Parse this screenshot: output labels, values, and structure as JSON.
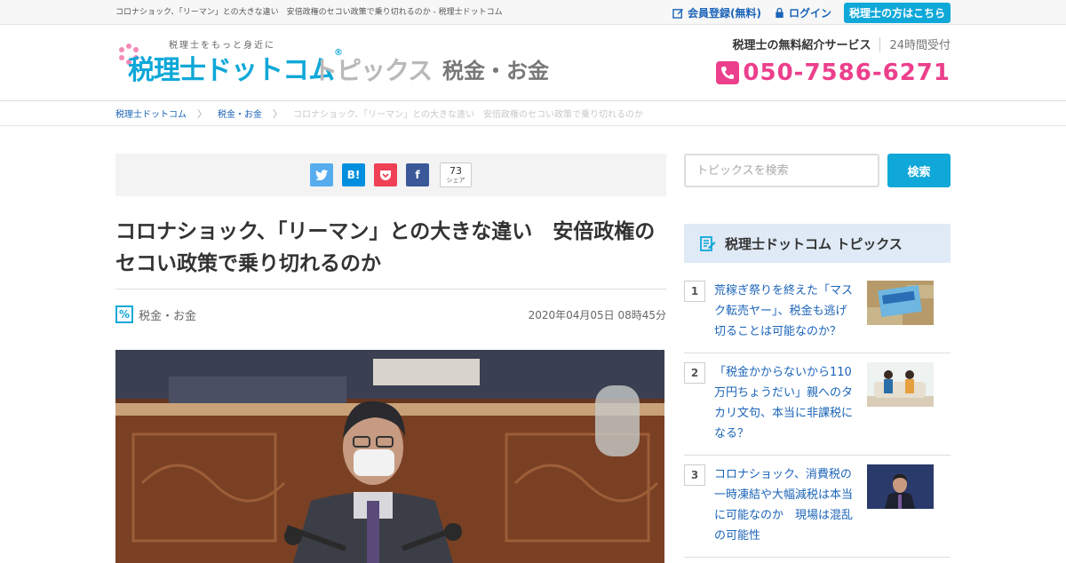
{
  "topbar": {
    "page_title": "コロナショック、「リーマン」との大きな違い　安倍政権のセコい政策で乗り切れるのか - 税理士ドットコム",
    "register": "会員登録(無料)",
    "login": "ログイン",
    "tax_accountant_link": "税理士の方はこちら"
  },
  "logo": {
    "tagline": "税理士をもっと身近に",
    "brand": "税理士ドットコム",
    "registered_mark": "®",
    "topics": "トピックス",
    "category": "税金・お金"
  },
  "header": {
    "service_name": "税理士の無料紹介サービス",
    "hours": "24時間受付",
    "phone": "050-7586-6271"
  },
  "breadcrumb": {
    "items": [
      "税理士ドットコム",
      "税金・お金"
    ],
    "separator": "〉",
    "current": "コロナショック、「リーマン」との大きな違い　安倍政権のセコい政策で乗り切れるのか"
  },
  "share": {
    "twitter_label": "",
    "hatena_label": "B!",
    "facebook_label": "f",
    "count": "73",
    "count_unit": "シェア"
  },
  "article": {
    "title": "コロナショック、「リーマン」との大きな違い　安倍政権のセコい政策で乗り切れるのか",
    "category_icon_label": "%",
    "category": "税金・お金",
    "date": "2020年04月05日 08時45分"
  },
  "sidebar": {
    "search_placeholder": "トピックスを検索",
    "search_button": "検索",
    "section_title": "税理士ドットコム トピックス",
    "ranking": [
      {
        "rank": "1",
        "title": "荒稼ぎ祭りを終えた「マスク転売ヤー」、税金も逃げ切ることは可能なのか？"
      },
      {
        "rank": "2",
        "title": "「税金かからないから110万円ちょうだい」親へのタカリ文句、本当に非課税になる？"
      },
      {
        "rank": "3",
        "title": "コロナショック、消費税の一時凍結や大幅減税は本当に可能なのか　現場は混乱の可能性"
      }
    ]
  },
  "colors": {
    "brand_blue": "#0fa8d8",
    "phone_pink": "#ec3f8c",
    "link_blue": "#1b64b8"
  }
}
